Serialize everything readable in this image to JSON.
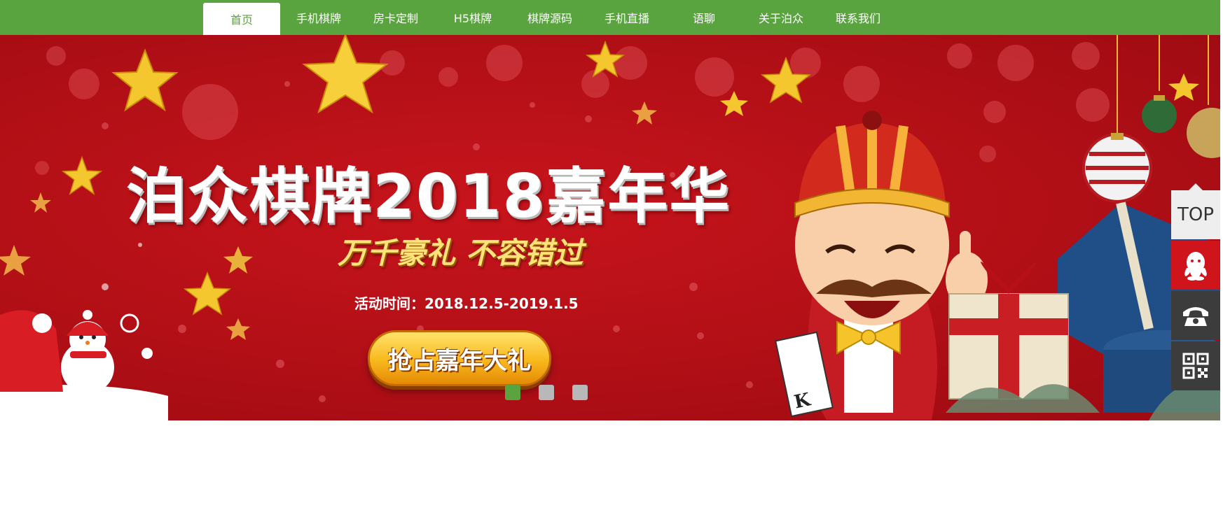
{
  "nav": {
    "items": [
      {
        "label": "首页",
        "active": true
      },
      {
        "label": "手机棋牌",
        "active": false
      },
      {
        "label": "房卡定制",
        "active": false
      },
      {
        "label": "H5棋牌",
        "active": false
      },
      {
        "label": "棋牌源码",
        "active": false
      },
      {
        "label": "手机直播",
        "active": false
      },
      {
        "label": "语聊",
        "active": false
      },
      {
        "label": "关于泊众",
        "active": false
      },
      {
        "label": "联系我们",
        "active": false
      }
    ]
  },
  "banner": {
    "headline": "泊众棋牌2018嘉年华",
    "subhead": "万千豪礼 不容错过",
    "event_time": "活动时间：2018.12.5-2019.1.5",
    "cta_label": "抢占嘉年大礼",
    "slide_count": 3,
    "active_slide": 1
  },
  "side_tools": {
    "top_label": "TOP",
    "icons": [
      "qq-icon",
      "phone-icon",
      "qrcode-icon"
    ]
  },
  "colors": {
    "nav_bg": "#5aa43f",
    "banner_bg": "#b10f16",
    "accent_gold": "#f8b81c",
    "tool_dark": "#3c3c3c",
    "qq_red": "#d0141c"
  }
}
